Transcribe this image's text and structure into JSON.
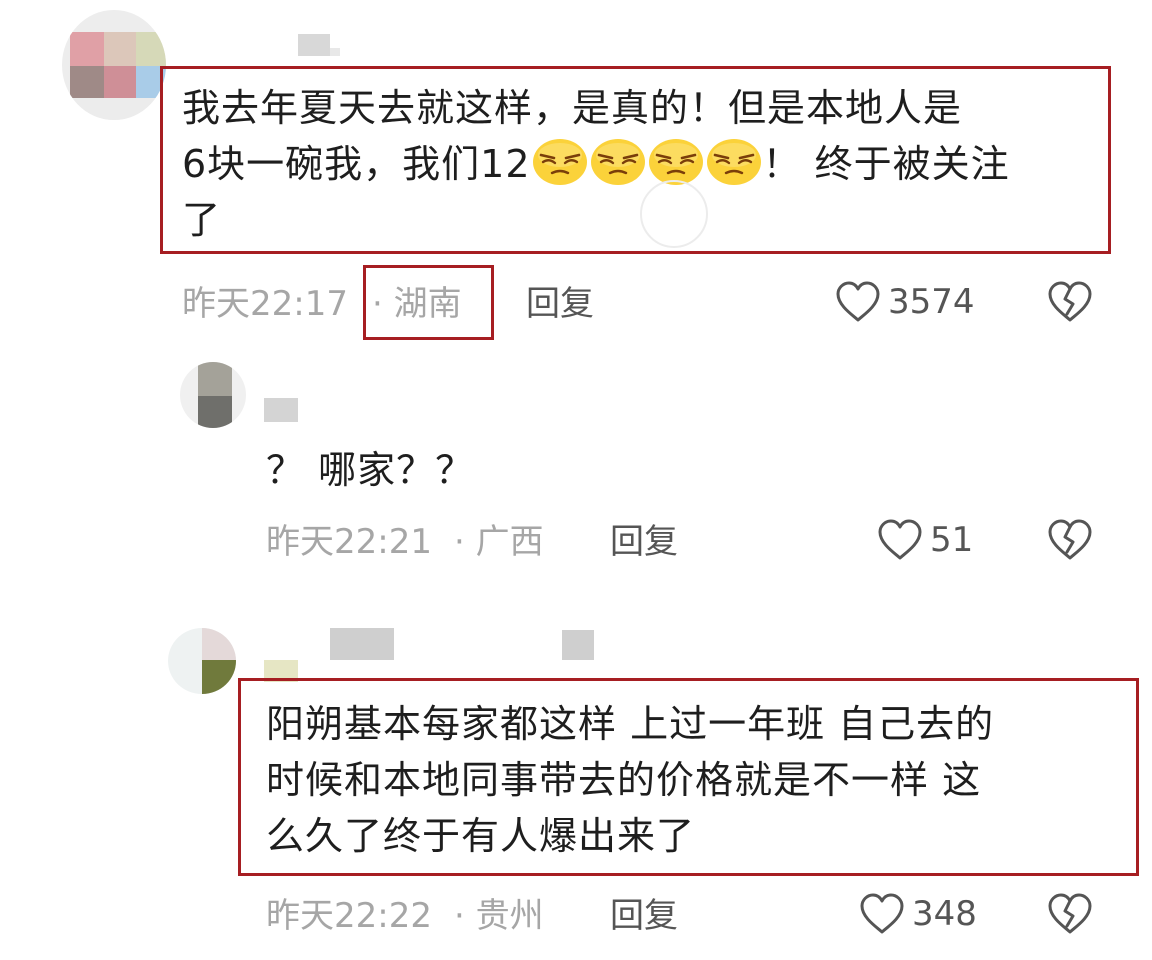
{
  "comments": [
    {
      "text_line1": "我去年夏天去就这样，是真的！但是本地人是",
      "text_line2_start": "6块一碗我，我们12",
      "emoji_name": "smirk-emoji",
      "emoji_count": 4,
      "text_line2_end": "！ 终于被关注",
      "text_line3": "了",
      "time": "昨天22:17",
      "location": "· 湖南",
      "reply_label": "回复",
      "likes": "3574"
    },
    {
      "text": "？ 哪家？？",
      "time": "昨天22:21",
      "location": "· 广西",
      "reply_label": "回复",
      "likes": "51"
    },
    {
      "text_line1": "阳朔基本每家都这样 上过一年班 自己去的",
      "text_line2": "时候和本地同事带去的价格就是不一样 这",
      "text_line3": "么久了终于有人爆出来了",
      "time": "昨天22:22",
      "location": "· 贵州",
      "reply_label": "回复",
      "likes": "348"
    }
  ],
  "colors": {
    "highlight_box": "#a61e22",
    "meta_text": "#a6a6a6",
    "action_text": "#555555",
    "body_text": "#1e1e1e"
  },
  "icons": [
    "heart-outline-icon",
    "broken-heart-icon",
    "smirk-emoji"
  ]
}
